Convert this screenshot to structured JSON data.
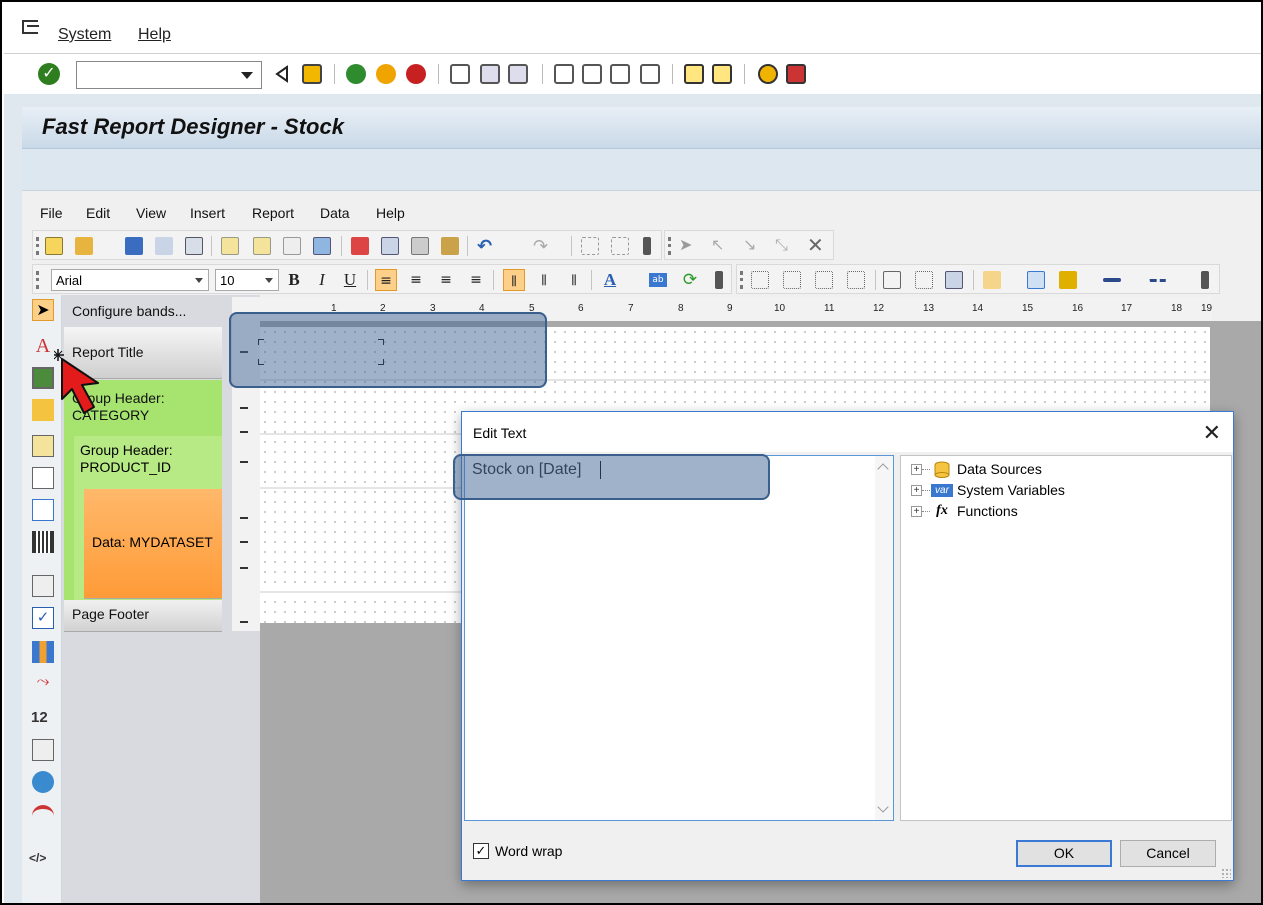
{
  "sap": {
    "menu": [
      "System",
      "Help"
    ]
  },
  "window": {
    "title": "Fast Report Designer - Stock"
  },
  "designer": {
    "menu": [
      "File",
      "Edit",
      "View",
      "Insert",
      "Report",
      "Data",
      "Help"
    ],
    "font": {
      "family": "Arial",
      "size": "10"
    },
    "bands": {
      "configure": "Configure bands...",
      "report_title": "Report Title",
      "group1": "Group Header:\nCATEGORY",
      "group2": "Group Header:\nPRODUCT_ID",
      "data": "Data: MYDATASET",
      "page_footer": "Page Footer"
    },
    "ruler": [
      "1",
      "2",
      "3",
      "4",
      "5",
      "6",
      "7",
      "8",
      "9",
      "10",
      "11",
      "12",
      "13",
      "14",
      "15",
      "16",
      "17",
      "18",
      "19"
    ],
    "side_labels": {
      "numeric": "12",
      "html": "</>"
    }
  },
  "dialog": {
    "title": "Edit Text",
    "text": "Stock on [Date]",
    "tree": [
      "Data Sources",
      "System Variables",
      "Functions"
    ],
    "tree_badges": {
      "var": "var",
      "fx": "fx"
    },
    "word_wrap": {
      "label": "Word wrap",
      "checked": true
    },
    "ok": "OK",
    "cancel": "Cancel"
  },
  "colors": {
    "highlight": "#3f6696",
    "group_band": "#a6e36f",
    "data_band": "#ff9b38",
    "accent": "#3b7ad4"
  }
}
